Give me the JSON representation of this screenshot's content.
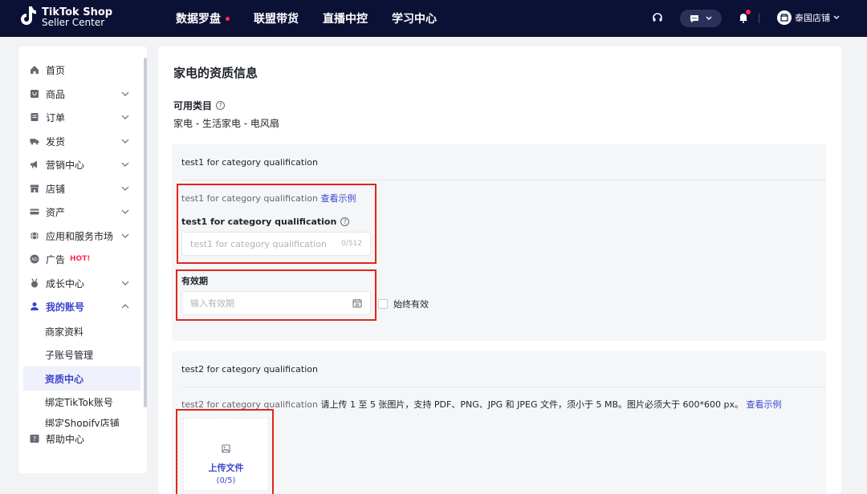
{
  "brand": {
    "line1": "TikTok Shop",
    "line2": "Seller Center"
  },
  "nav": [
    {
      "label": "数据罗盘",
      "has_dot": true
    },
    {
      "label": "联盟带货"
    },
    {
      "label": "直播中控"
    },
    {
      "label": "学习中心"
    }
  ],
  "header_right": {
    "shop_name": "泰国店铺"
  },
  "sidebar": {
    "items": [
      {
        "label": "首页",
        "icon": "home-icon"
      },
      {
        "label": "商品",
        "icon": "product-icon"
      },
      {
        "label": "订单",
        "icon": "order-icon"
      },
      {
        "label": "发货",
        "icon": "truck-icon"
      },
      {
        "label": "营销中心",
        "icon": "megaphone-icon"
      },
      {
        "label": "店铺",
        "icon": "store-icon"
      },
      {
        "label": "资产",
        "icon": "card-icon"
      },
      {
        "label": "应用和服务市场",
        "icon": "globe-icon"
      },
      {
        "label": "广告",
        "badge": "HOT!",
        "icon": "ad-icon"
      },
      {
        "label": "成长中心",
        "icon": "medal-icon"
      },
      {
        "label": "我的账号",
        "icon": "user-icon"
      }
    ],
    "account_sub": [
      {
        "label": "商家资料"
      },
      {
        "label": "子账号管理"
      },
      {
        "label": "资质中心"
      },
      {
        "label": "绑定TikTok账号"
      },
      {
        "label": "绑定Shopify店铺"
      }
    ],
    "help": {
      "label": "帮助中心"
    }
  },
  "main": {
    "title": "家电的资质信息",
    "category_label": "可用类目",
    "category_value": "家电 - 生活家电 - 电风扇",
    "panel1": {
      "title": "test1 for category qualification",
      "hint": "test1 for category qualification",
      "example_link": "查看示例",
      "field_label": "test1 for category qualification",
      "input_placeholder": "test1 for category qualification",
      "input_count": "0/512",
      "validity_label": "有效期",
      "validity_placeholder": "输入有效期",
      "always_valid_label": "始终有效"
    },
    "panel2": {
      "title": "test2 for category qualification",
      "hint_prefix": "test2 for category qualification",
      "hint_body": " 请上传 1 至 5 张图片，支持 PDF、PNG、JPG 和 JPEG 文件，须小于 5 MB。图片必须大于 600*600 px。",
      "example_link": "查看示例",
      "upload_label": "上传文件",
      "upload_count": "(0/5)"
    }
  },
  "colors": {
    "topbar": "#0b1035",
    "accent": "#3b45cf",
    "hot": "#fe2c55",
    "annotation": "#e0261b"
  }
}
